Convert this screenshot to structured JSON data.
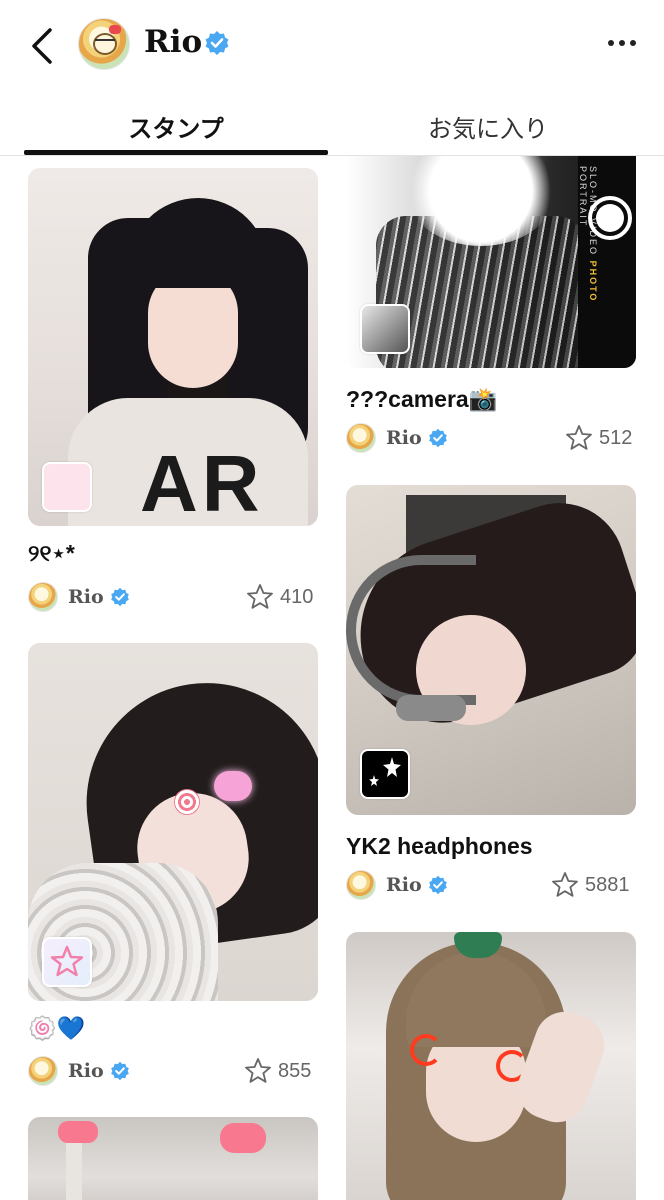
{
  "header": {
    "username": "Rio",
    "back_icon": "chevron-left-icon",
    "more_icon": "more-horizontal-icon",
    "verified_color": "#4aa8f2"
  },
  "tabs": [
    {
      "label": "スタンプ",
      "active": true
    },
    {
      "label": "お気に入り",
      "active": false
    }
  ],
  "cards": [
    {
      "id": "card1",
      "title": "୨୧⋆*",
      "author": "Rio",
      "likes": "410"
    },
    {
      "id": "card2",
      "title": "???camera📸",
      "author": "Rio",
      "likes": "512"
    },
    {
      "id": "card3",
      "title": "YK2 headphones",
      "author": "Rio",
      "likes": "5881"
    },
    {
      "id": "card4",
      "title": "🍥💙",
      "author": "Rio",
      "likes": "855"
    }
  ],
  "camera_modes": {
    "slomo": "SLO-MO",
    "video": "VIDEO",
    "photo": "PHOTO",
    "portrait": "PORTRAIT"
  },
  "sweater_text": "AR"
}
